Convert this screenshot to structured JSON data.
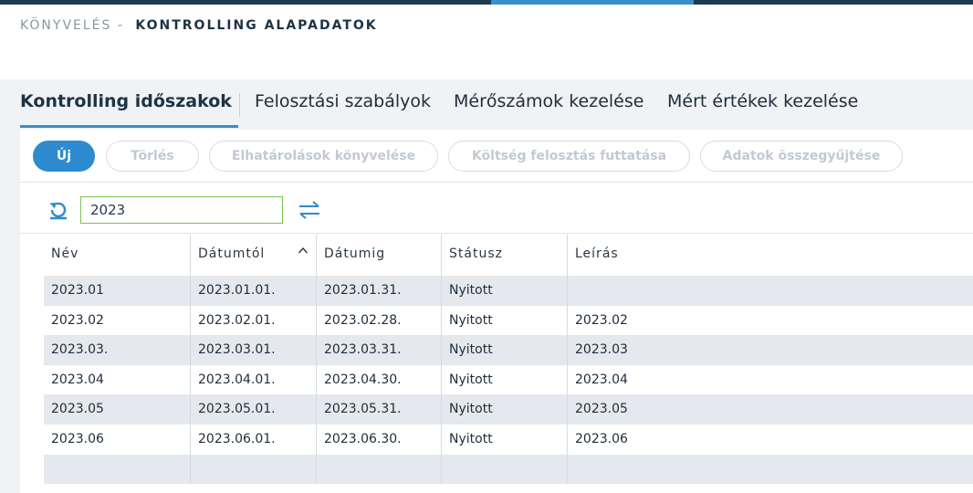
{
  "breadcrumb": {
    "parent": "KÖNYVELÉS -",
    "current": "KONTROLLING ALAPADATOK"
  },
  "tabs": [
    {
      "label": "Kontrolling időszakok",
      "active": true
    },
    {
      "label": "Felosztási szabályok",
      "active": false
    },
    {
      "label": "Mérőszámok kezelése",
      "active": false
    },
    {
      "label": "Mért értékek kezelése",
      "active": false
    }
  ],
  "toolbar": {
    "new_label": "Új",
    "delete_label": "Törlés",
    "accrual_label": "Elhatárolások könyvelése",
    "cost_alloc_label": "Költség felosztás futtatása",
    "collect_label": "Adatok összegyűjtése"
  },
  "filter": {
    "year_value": "2023"
  },
  "colors": {
    "accent": "#3a8ec9",
    "primary_button": "#2e8bd0",
    "input_border": "#7cc24a"
  },
  "icons": {
    "refresh": "refresh-icon",
    "swap": "swap-arrows-icon",
    "sort": "sort-ascending-icon"
  },
  "table": {
    "columns": [
      "Név",
      "Dátumtól",
      "Dátumig",
      "Státusz",
      "Leírás"
    ],
    "rows": [
      [
        "2023.01",
        "2023.01.01.",
        "2023.01.31.",
        "Nyitott",
        ""
      ],
      [
        "2023.02",
        "2023.02.01.",
        "2023.02.28.",
        "Nyitott",
        "2023.02"
      ],
      [
        "2023.03.",
        "2023.03.01.",
        "2023.03.31.",
        "Nyitott",
        "2023.03"
      ],
      [
        "2023.04",
        "2023.04.01.",
        "2023.04.30.",
        "Nyitott",
        "2023.04"
      ],
      [
        "2023.05",
        "2023.05.01.",
        "2023.05.31.",
        "Nyitott",
        "2023.05"
      ],
      [
        "2023.06",
        "2023.06.01.",
        "2023.06.30.",
        "Nyitott",
        "2023.06"
      ],
      [
        "",
        "",
        "",
        "",
        ""
      ]
    ]
  }
}
